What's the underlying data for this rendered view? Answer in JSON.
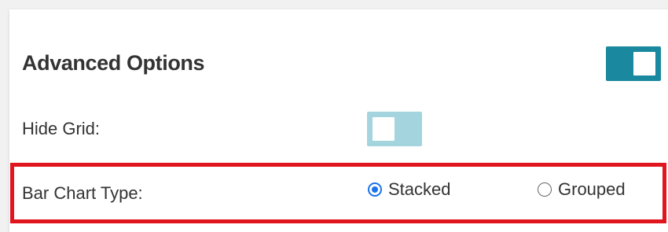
{
  "advanced_options": {
    "title": "Advanced Options",
    "enabled": true
  },
  "hide_grid": {
    "label": "Hide Grid:",
    "enabled": false
  },
  "bar_chart_type": {
    "label": "Bar Chart Type:",
    "options": [
      "Stacked",
      "Grouped"
    ],
    "selected": "Stacked"
  },
  "colors": {
    "toggle_on": "#1a889e",
    "toggle_off": "#a4d4dd",
    "radio_selected": "#1a73e8",
    "highlight_border": "#e0151e"
  }
}
